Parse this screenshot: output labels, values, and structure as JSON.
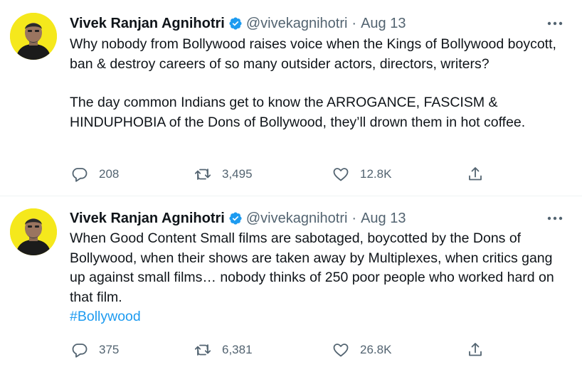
{
  "colors": {
    "text": "#0f1419",
    "secondary": "#536471",
    "link": "#1d9bf0",
    "verified": "#1d9bf0",
    "avatar_bg": "#f5e81c",
    "divider": "#eff3f4"
  },
  "tweets": [
    {
      "name": "Vivek Ranjan Agnihotri",
      "verified_icon": "verified-badge-icon",
      "handle": "@vivekagnihotri",
      "separator": "·",
      "date": "Aug 13",
      "text_paragraphs": [
        "Why nobody from Bollywood raises voice when the Kings of Bollywood boycott, ban & destroy careers of so many outsider actors, directors, writers?",
        "The day common Indians get to know the ARROGANCE, FASCISM & HINDUPHOBIA of the Dons of Bollywood, they’ll drown them in hot coffee."
      ],
      "hashtag": "",
      "replies": "208",
      "retweets": "3,495",
      "likes": "12.8K"
    },
    {
      "name": "Vivek Ranjan Agnihotri",
      "verified_icon": "verified-badge-icon",
      "handle": "@vivekagnihotri",
      "separator": "·",
      "date": "Aug 13",
      "text_paragraphs": [
        "When Good Content Small films are sabotaged, boycotted by the Dons of Bollywood, when their shows are taken away by Multiplexes, when critics gang up against small films… nobody thinks of 250 poor people who worked hard on that film."
      ],
      "hashtag": "#Bollywood",
      "replies": "375",
      "retweets": "6,381",
      "likes": "26.8K"
    }
  ]
}
